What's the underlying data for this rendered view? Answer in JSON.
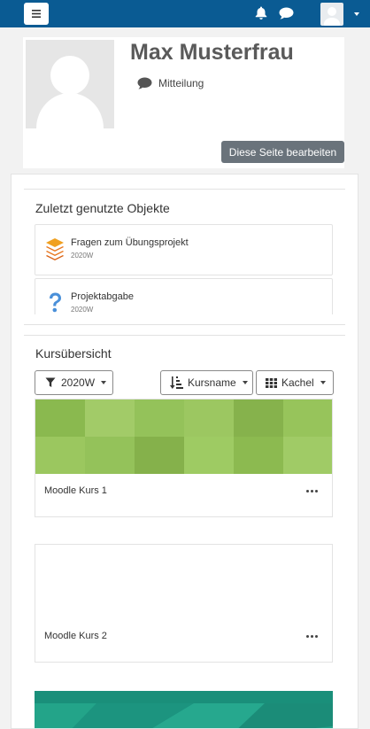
{
  "navbar": {
    "menu_icon": "hamburger-icon",
    "notifications_icon": "bell-icon",
    "messages_icon": "chat-icon",
    "user_avatar": "user-avatar",
    "colors": {
      "background": "#0a5b93"
    }
  },
  "profile": {
    "name": "Max Musterfrau",
    "message_label": "Mitteilung",
    "edit_button_label": "Diese Seite bearbeiten"
  },
  "recent_items": {
    "title": "Zuletzt genutzte Objekte",
    "items": [
      {
        "name": "Fragen zum Übungsprojekt",
        "course": "2020W",
        "icon": "quiz-layers-icon"
      },
      {
        "name": "Projektabgabe",
        "course": "2020W",
        "icon": "question-icon"
      }
    ]
  },
  "course_overview": {
    "title": "Kursübersicht",
    "filter_label": "2020W",
    "sort_label": "Kursname",
    "view_label": "Kachel",
    "courses": [
      {
        "name": "Moodle Kurs 1",
        "image": "green-tiles"
      },
      {
        "name": "Moodle Kurs 2",
        "image": "none"
      },
      {
        "name": "",
        "image": "teal-polygons"
      }
    ]
  }
}
